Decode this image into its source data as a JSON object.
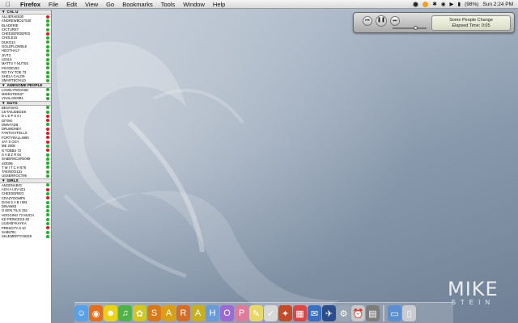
{
  "menubar": {
    "apple_icon": "apple-icon",
    "items": [
      "Firefox",
      "File",
      "Edit",
      "View",
      "Go",
      "Bookmarks",
      "Tools",
      "Window",
      "Help"
    ],
    "battery": "(98%)",
    "clock": "Sun 2:24 PM"
  },
  "itunes": {
    "song": "Some People Change",
    "elapsed": "Elapsed Time: 0:05"
  },
  "signature": {
    "line1": "MIKE",
    "line2": "STEIN"
  },
  "buddylist": {
    "groups": [
      {
        "name": "CAL U",
        "buddies": [
          {
            "name": "ALLIERAE530",
            "status": "away"
          },
          {
            "name": "ANDREWBOLT530",
            "status": "avail"
          },
          {
            "name": "BLADERIE",
            "status": "avail"
          },
          {
            "name": "CICTURE7",
            "status": "avail"
          },
          {
            "name": "CHEESERIDER03",
            "status": "away"
          },
          {
            "name": "CHOLE15",
            "status": "avail"
          },
          {
            "name": "DUKO13",
            "status": "avail"
          },
          {
            "name": "GOLDFLOW815",
            "status": "avail"
          },
          {
            "name": "HEOTHALY",
            "status": "avail"
          },
          {
            "name": "JIVT3",
            "status": "avail"
          },
          {
            "name": "LESL5",
            "status": "avail"
          },
          {
            "name": "MATTS Y NUTSS",
            "status": "avail"
          },
          {
            "name": "PSYDEV93",
            "status": "avail"
          },
          {
            "name": "RO TAY TOE 73",
            "status": "avail"
          },
          {
            "name": "SHELA CALO9",
            "status": "avail"
          },
          {
            "name": "SMARTECHILD",
            "status": "avail"
          }
        ]
      },
      {
        "name": "AWESOME PEOPLE",
        "buddies": [
          {
            "name": "LOVELYROCK88",
            "status": "avail"
          },
          {
            "name": "MIKESTEIN37",
            "status": "avail"
          },
          {
            "name": "VIVALAD0381",
            "status": "avail"
          }
        ]
      },
      {
        "name": "GUYS",
        "buddies": [
          {
            "name": "BENYSHO",
            "status": "avail"
          },
          {
            "name": "CETAKJDEDDS",
            "status": "avail"
          },
          {
            "name": "D L E P S K I",
            "status": "away"
          },
          {
            "name": "DITSKI",
            "status": "away"
          },
          {
            "name": "DMNYAD8",
            "status": "avail"
          },
          {
            "name": "DRUMONEY",
            "status": "away"
          },
          {
            "name": "FANTASYFELLS",
            "status": "away"
          },
          {
            "name": "FORTYBALL4980",
            "status": "away"
          },
          {
            "name": "JAY S OGY",
            "status": "away"
          },
          {
            "name": "ME 2005",
            "status": "avail"
          },
          {
            "name": "N TOBBS 72",
            "status": "away"
          },
          {
            "name": "S A B Z R 64",
            "status": "avail"
          },
          {
            "name": "SABERNCSR0069",
            "status": "avail"
          },
          {
            "name": "SOD95",
            "status": "avail"
          },
          {
            "name": "T W I T C H 576",
            "status": "avail"
          },
          {
            "name": "TAEWOO131",
            "status": "avail"
          },
          {
            "name": "USSERROCT96",
            "status": "avail"
          }
        ]
      },
      {
        "name": "GIRLS",
        "buddies": [
          {
            "name": "ANGENABIG",
            "status": "avail"
          },
          {
            "name": "ASH A LEV 821",
            "status": "away"
          },
          {
            "name": "CHEESERIEG",
            "status": "avail"
          },
          {
            "name": "CRAZYDOMF5",
            "status": "away"
          },
          {
            "name": "DANI S A B I 981",
            "status": "avail"
          },
          {
            "name": "DINAM83",
            "status": "avail"
          },
          {
            "name": "G EEN TIL E 251",
            "status": "avail"
          },
          {
            "name": "HOGGING 72 MUCH",
            "status": "avail"
          },
          {
            "name": "KD PRINCESS 82",
            "status": "avail"
          },
          {
            "name": "LILBABYKAYKA",
            "status": "avail"
          },
          {
            "name": "PRESCITA 6 10",
            "status": "away"
          },
          {
            "name": "SAB8781",
            "status": "avail"
          },
          {
            "name": "SKLEMERTY49229",
            "status": "avail"
          }
        ]
      }
    ]
  },
  "dock": [
    {
      "icon": "finder-icon",
      "glyph": "☺",
      "color": "#5aa0e6"
    },
    {
      "icon": "firefox-icon",
      "glyph": "◉",
      "color": "#e0701f"
    },
    {
      "icon": "adium-duck-icon",
      "glyph": "☻",
      "color": "#e8d21a"
    },
    {
      "icon": "itunes-icon",
      "glyph": "♫",
      "color": "#4fb24a"
    },
    {
      "icon": "photo-app-icon",
      "glyph": "✿",
      "color": "#d4c51f"
    },
    {
      "icon": "s-letter-icon",
      "glyph": "S",
      "color": "#d87a1a"
    },
    {
      "icon": "a-letter-icon",
      "glyph": "A",
      "color": "#d8a01a"
    },
    {
      "icon": "r-letter-icon",
      "glyph": "R",
      "color": "#d56d2a"
    },
    {
      "icon": "a2-letter-icon",
      "glyph": "A",
      "color": "#c7b020"
    },
    {
      "icon": "h-letter-icon",
      "glyph": "H",
      "color": "#6a9bd6"
    },
    {
      "icon": "o-letter-icon",
      "glyph": "O",
      "color": "#9a6cd0"
    },
    {
      "icon": "p-letter-icon",
      "glyph": "P",
      "color": "#e07a9a"
    },
    {
      "icon": "stickies-icon",
      "glyph": "✎",
      "color": "#e8d76a"
    },
    {
      "icon": "textedit-icon",
      "glyph": "✓",
      "color": "#d8d8d8"
    },
    {
      "icon": "palette-icon",
      "glyph": "✦",
      "color": "#c24c2a"
    },
    {
      "icon": "ical-icon",
      "glyph": "▦",
      "color": "#d44"
    },
    {
      "icon": "mail-icon",
      "glyph": "✉",
      "color": "#3c6fbf"
    },
    {
      "icon": "bird-icon",
      "glyph": "✈",
      "color": "#2d4c8a"
    },
    {
      "icon": "system-prefs-icon",
      "glyph": "⚙",
      "color": "#9aa6b4"
    },
    {
      "icon": "alarm-clock-icon",
      "glyph": "⏰",
      "color": "#c8c8c8"
    },
    {
      "icon": "calculator-icon",
      "glyph": "▤",
      "color": "#7d7d7d"
    },
    {
      "icon": "documents-folder-icon",
      "glyph": "▭",
      "color": "#5b8fd0"
    },
    {
      "icon": "trash-icon",
      "glyph": "▯",
      "color": "#c9cdd2"
    }
  ]
}
